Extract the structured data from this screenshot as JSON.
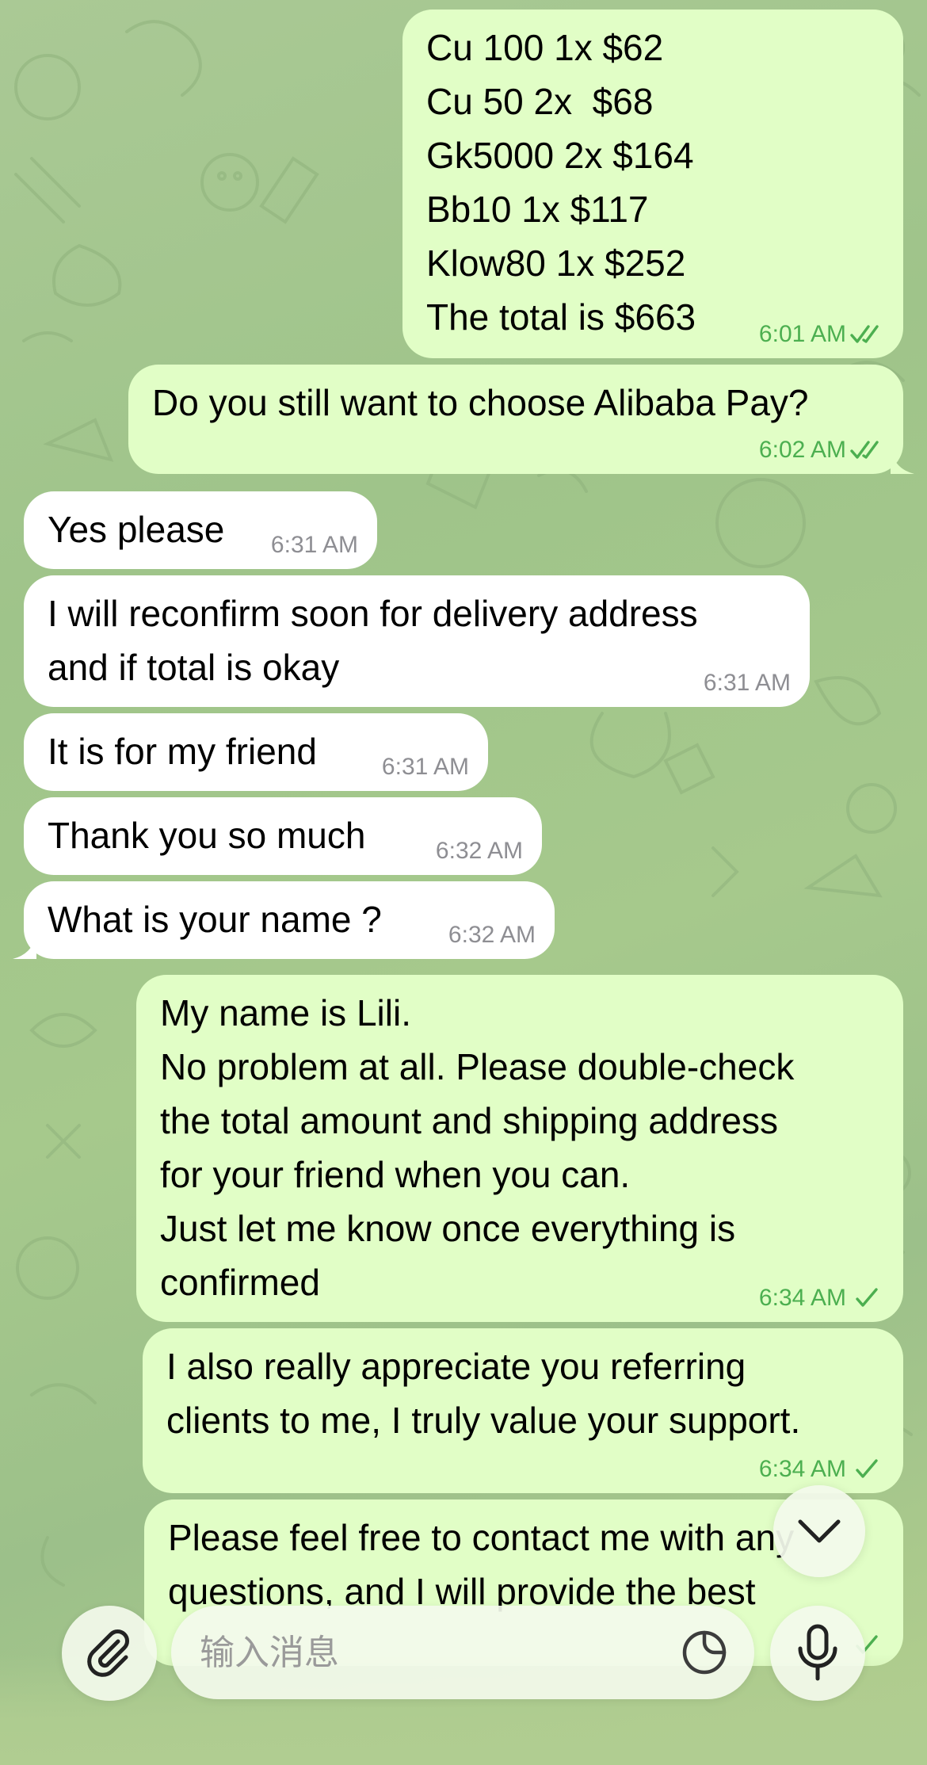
{
  "messages": [
    {
      "dir": "out",
      "lines": [
        "Cu 100 1x $62",
        "Cu 50 2x  $68",
        "Gk5000 2x $164",
        "Bb10 1x $117",
        "Klow80 1x $252",
        "The total is $663"
      ],
      "time": "6:01 AM",
      "status": "read"
    },
    {
      "dir": "out",
      "lines": [
        "Do you still want to choose Alibaba Pay?"
      ],
      "time": "6:02 AM",
      "status": "read"
    },
    {
      "dir": "in",
      "lines": [
        "Yes please"
      ],
      "time": "6:31 AM"
    },
    {
      "dir": "in",
      "lines": [
        "I will reconfirm soon for delivery address",
        "and if total is okay"
      ],
      "time": "6:31 AM"
    },
    {
      "dir": "in",
      "lines": [
        "It is for my friend"
      ],
      "time": "6:31 AM"
    },
    {
      "dir": "in",
      "lines": [
        "Thank you so much"
      ],
      "time": "6:32 AM"
    },
    {
      "dir": "in",
      "lines": [
        "What is your name ?"
      ],
      "time": "6:32 AM"
    },
    {
      "dir": "out",
      "lines": [
        "My name is Lili.",
        "No problem at all. Please double-check",
        "the total amount and shipping address",
        "for your friend when you can.",
        "Just let me know once everything is",
        "confirmed"
      ],
      "time": "6:34 AM",
      "status": "sent"
    },
    {
      "dir": "out",
      "lines": [
        "I also really appreciate you referring",
        "clients to me, I truly value your support."
      ],
      "time": "6:34 AM",
      "status": "sent"
    },
    {
      "dir": "out",
      "lines": [
        "Please feel free to contact me with any",
        "questions, and I will provide the best"
      ],
      "time": "",
      "status": "sent"
    }
  ],
  "composer": {
    "placeholder": "输入消息",
    "attach_icon": "paperclip-icon",
    "sticker_icon": "sticker-icon",
    "mic_icon": "microphone-icon"
  },
  "scroll_down_icon": "chevron-down-icon",
  "colors": {
    "outgoing_bubble": "#e1fec6",
    "incoming_bubble": "#ffffff",
    "outgoing_time": "#4caf50",
    "incoming_time": "#8e8e93"
  }
}
